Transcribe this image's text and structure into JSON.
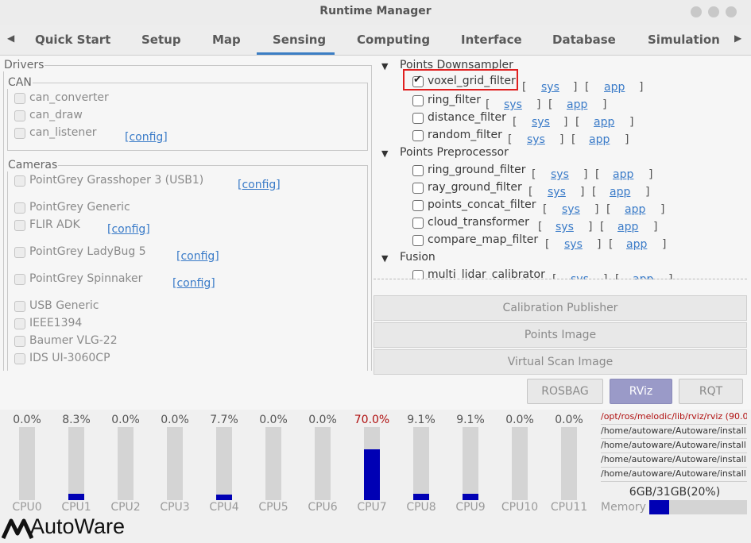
{
  "window": {
    "title": "Runtime Manager"
  },
  "tabs": [
    "Quick Start",
    "Setup",
    "Map",
    "Sensing",
    "Computing",
    "Interface",
    "Database",
    "Simulation"
  ],
  "selected_tab": "Sensing",
  "drivers": {
    "label": "Drivers",
    "can": {
      "label": "CAN",
      "items": [
        "can_converter",
        "can_draw",
        "can_listener"
      ],
      "config": "[config]"
    },
    "cameras": {
      "label": "Cameras",
      "items": [
        "PointGrey Grasshoper 3 (USB1)",
        "PointGrey Generic",
        "FLIR ADK",
        "PointGrey LadyBug 5",
        "PointGrey Spinnaker",
        "USB Generic",
        "IEEE1394",
        "Baumer VLG-22",
        "IDS UI-3060CP"
      ],
      "config": "[config]"
    }
  },
  "sections": [
    {
      "label": "Points Downsampler",
      "items": [
        {
          "name": "voxel_grid_filter",
          "checked": true
        },
        {
          "name": "ring_filter",
          "checked": false
        },
        {
          "name": "distance_filter",
          "checked": false
        },
        {
          "name": "random_filter",
          "checked": false
        }
      ]
    },
    {
      "label": "Points Preprocessor",
      "items": [
        {
          "name": "ring_ground_filter",
          "checked": false
        },
        {
          "name": "ray_ground_filter",
          "checked": false
        },
        {
          "name": "points_concat_filter",
          "checked": false
        },
        {
          "name": "cloud_transformer",
          "checked": false
        },
        {
          "name": "compare_map_filter",
          "checked": false
        }
      ]
    },
    {
      "label": "Fusion",
      "items": [
        {
          "name": "multi_lidar_calibrator",
          "checked": false
        }
      ]
    }
  ],
  "links": {
    "sys": "sys",
    "app": "app",
    "open": "[",
    "close": "]"
  },
  "buttons": {
    "calibration_publisher": "Calibration Publisher",
    "points_image": "Points Image",
    "virtual_scan_image": "Virtual Scan Image",
    "rosbag": "ROSBAG",
    "rviz": "RViz",
    "rqt": "RQT"
  },
  "cpus": [
    {
      "label": "CPU0",
      "pct": "0.0%",
      "value": 0.0
    },
    {
      "label": "CPU1",
      "pct": "8.3%",
      "value": 8.3
    },
    {
      "label": "CPU2",
      "pct": "0.0%",
      "value": 0.0
    },
    {
      "label": "CPU3",
      "pct": "0.0%",
      "value": 0.0
    },
    {
      "label": "CPU4",
      "pct": "7.7%",
      "value": 7.7
    },
    {
      "label": "CPU5",
      "pct": "0.0%",
      "value": 0.0
    },
    {
      "label": "CPU6",
      "pct": "0.0%",
      "value": 0.0
    },
    {
      "label": "CPU7",
      "pct": "70.0%",
      "value": 70.0
    },
    {
      "label": "CPU8",
      "pct": "9.1%",
      "value": 9.1
    },
    {
      "label": "CPU9",
      "pct": "9.1%",
      "value": 9.1
    },
    {
      "label": "CPU10",
      "pct": "0.0%",
      "value": 0.0
    },
    {
      "label": "CPU11",
      "pct": "0.0%",
      "value": 0.0
    }
  ],
  "processes": [
    "/opt/ros/melodic/lib/rviz/rviz (90.0",
    "/home/autoware/Autoware/install",
    "/home/autoware/Autoware/install",
    "/home/autoware/Autoware/install",
    "/home/autoware/Autoware/install"
  ],
  "memory": {
    "text": "6GB/31GB(20%)",
    "label": "Memory",
    "value": 20
  },
  "logo": "AutoWare",
  "colors": {
    "accent": "#3c7ec4",
    "cpu_bar": "#0000b4",
    "highlight": "#e02020",
    "alert": "#b01010",
    "rviz_btn": "#9a9ac8"
  }
}
